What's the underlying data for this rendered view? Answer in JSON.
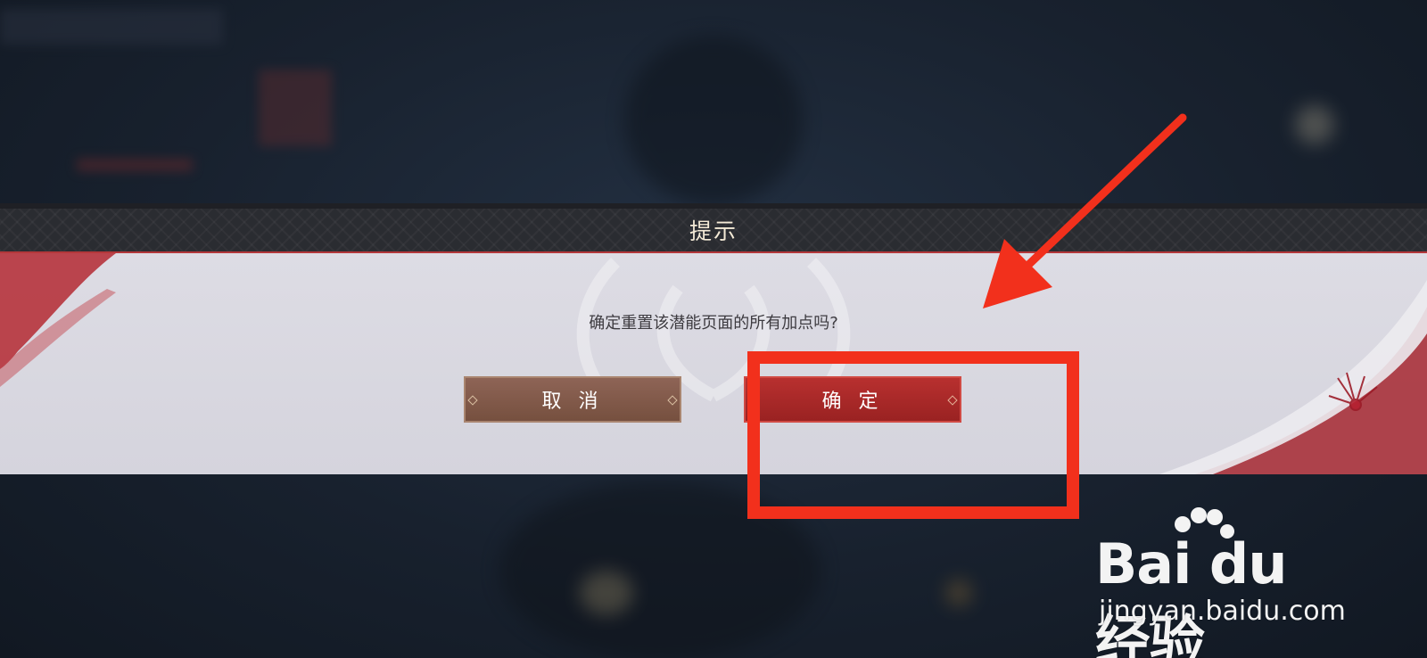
{
  "dialog": {
    "title": "提示",
    "message": "确定重置该潜能页面的所有加点吗?",
    "cancel_label": "取 消",
    "confirm_label": "确 定"
  },
  "watermark": {
    "logo": "Bai du 经验",
    "url": "jingyan.baidu.com"
  },
  "colors": {
    "header_bg": "#2a2c31",
    "body_bg": "#dddce4",
    "cancel_button": "#8e6456",
    "confirm_button": "#b8302f",
    "annotation": "#f2301c"
  }
}
